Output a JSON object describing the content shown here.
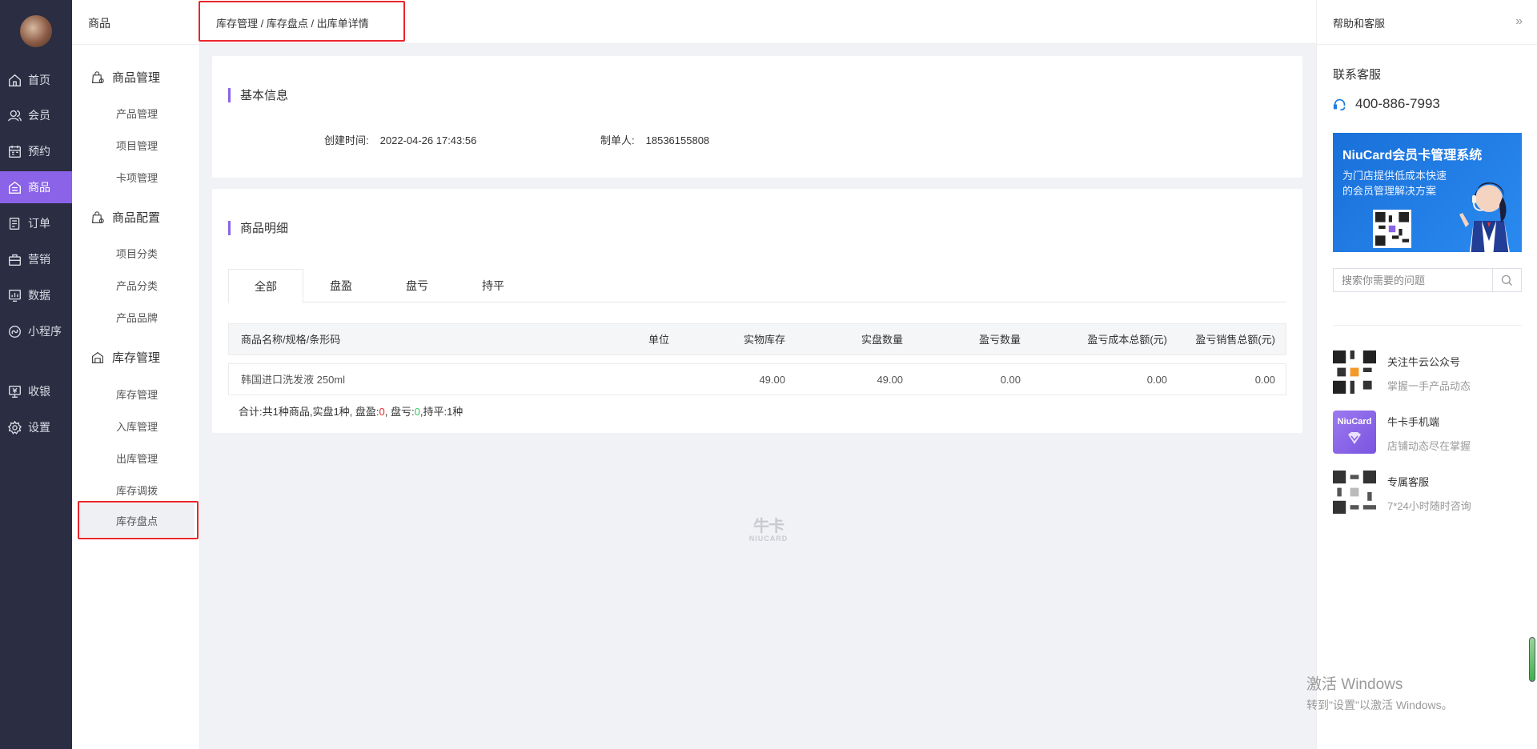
{
  "nav": {
    "items": [
      {
        "label": "首页",
        "icon": "home-icon"
      },
      {
        "label": "会员",
        "icon": "users-icon"
      },
      {
        "label": "预约",
        "icon": "calendar-icon"
      },
      {
        "label": "商品",
        "icon": "store-icon",
        "active": true
      },
      {
        "label": "订单",
        "icon": "order-icon"
      },
      {
        "label": "营销",
        "icon": "marketing-icon"
      },
      {
        "label": "数据",
        "icon": "chart-icon"
      },
      {
        "label": "小程序",
        "icon": "miniprogram-icon"
      },
      {
        "label": "收银",
        "icon": "cashier-icon"
      },
      {
        "label": "设置",
        "icon": "gear-icon"
      }
    ]
  },
  "submenu": {
    "title": "商品",
    "groups": [
      {
        "label": "商品管理",
        "items": [
          "产品管理",
          "项目管理",
          "卡项管理"
        ]
      },
      {
        "label": "商品配置",
        "items": [
          "项目分类",
          "产品分类",
          "产品品牌"
        ]
      },
      {
        "label": "库存管理",
        "items": [
          "库存管理",
          "入库管理",
          "出库管理",
          "库存调拨",
          "库存盘点"
        ]
      }
    ],
    "active_item": "库存盘点"
  },
  "header": {
    "breadcrumb": "库存管理 / 库存盘点 / 出库单详情"
  },
  "basic_info": {
    "title": "基本信息",
    "created_label": "创建时间:",
    "created_value": "2022-04-26 17:43:56",
    "maker_label": "制单人:",
    "maker_value": "18536155808"
  },
  "detail": {
    "title": "商品明细",
    "tabs": [
      "全部",
      "盘盈",
      "盘亏",
      "持平"
    ],
    "active_tab": "全部",
    "columns": [
      "商品名称/规格/条形码",
      "单位",
      "实物库存",
      "实盘数量",
      "盈亏数量",
      "盈亏成本总额(元)",
      "盈亏销售总额(元)"
    ],
    "rows": [
      [
        "韩国进口洗发液 250ml",
        "",
        "49.00",
        "49.00",
        "0.00",
        "0.00",
        "0.00"
      ]
    ],
    "summary": {
      "prefix": "合计:共1种商品,实盘1种, 盘盈:",
      "gain": "0",
      "mid": ", 盘亏:",
      "loss": "0",
      "suffix": ",持平:1种"
    }
  },
  "watermark": {
    "main": "牛卡",
    "sub": "NIUCARD"
  },
  "help": {
    "title": "帮助和客服",
    "collapse_icon": "»",
    "contact_label": "联系客服",
    "phone": "400-886-7993",
    "banner": {
      "title": "NiuCard会员卡管理系统",
      "subtitle": "为门店提供低成本快速的会员管理解决方案"
    },
    "search_placeholder": "搜索你需要的问题",
    "promos": [
      {
        "title": "关注牛云公众号",
        "subtitle": "掌握一手产品动态"
      },
      {
        "title": "牛卡手机端",
        "subtitle": "店铺动态尽在掌握",
        "badge": "NiuCard"
      },
      {
        "title": "专属客服",
        "subtitle": "7*24小时随时咨询"
      }
    ]
  },
  "windows_watermark": {
    "line1": "激活 Windows",
    "line2": "转到\"设置\"以激活 Windows。"
  },
  "colors": {
    "accent": "#8a63e8",
    "nav_bg": "#2b2d42",
    "highlight": "#e8262b",
    "gain": "#e8262b",
    "loss": "#2ec85b"
  }
}
